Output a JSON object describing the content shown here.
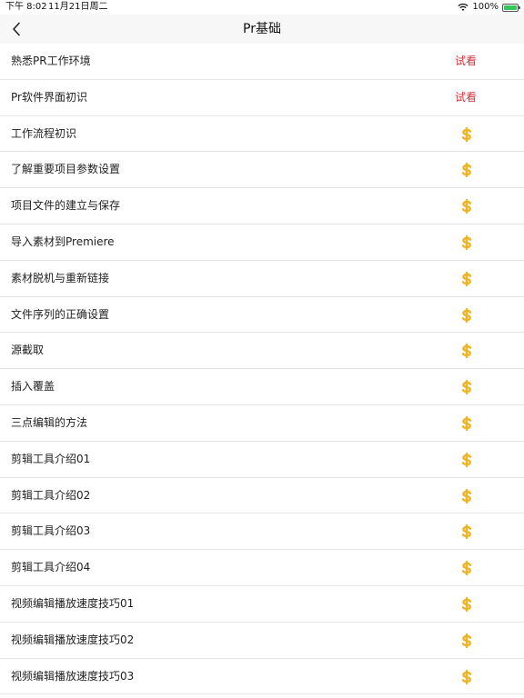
{
  "status_bar": {
    "time": "下午 8:02",
    "date": "11月21日周二",
    "battery": "100%",
    "wifi_icon": "wifi-icon",
    "battery_icon": "battery-icon",
    "battery_level": 1.0
  },
  "nav": {
    "title": "Pr基础",
    "back_icon": "chevron-left-icon"
  },
  "colors": {
    "trial": "#c8343a",
    "coin": "#f0b323",
    "nav_bg": "#f7f7f7",
    "divider": "#e6e6e6"
  },
  "lessons": [
    {
      "title": "熟悉PR工作环境",
      "badge": "试看",
      "type": "trial"
    },
    {
      "title": "Pr软件界面初识",
      "badge": "试看",
      "type": "trial"
    },
    {
      "title": "工作流程初识",
      "badge": "dollar-icon",
      "type": "paid"
    },
    {
      "title": "了解重要项目参数设置",
      "badge": "dollar-icon",
      "type": "paid"
    },
    {
      "title": "项目文件的建立与保存",
      "badge": "dollar-icon",
      "type": "paid"
    },
    {
      "title": "导入素材到Premiere",
      "badge": "dollar-icon",
      "type": "paid"
    },
    {
      "title": "素材脱机与重新链接",
      "badge": "dollar-icon",
      "type": "paid"
    },
    {
      "title": "文件序列的正确设置",
      "badge": "dollar-icon",
      "type": "paid"
    },
    {
      "title": "源截取",
      "badge": "dollar-icon",
      "type": "paid"
    },
    {
      "title": "插入覆盖",
      "badge": "dollar-icon",
      "type": "paid"
    },
    {
      "title": "三点编辑的方法",
      "badge": "dollar-icon",
      "type": "paid"
    },
    {
      "title": "剪辑工具介绍01",
      "badge": "dollar-icon",
      "type": "paid"
    },
    {
      "title": "剪辑工具介绍02",
      "badge": "dollar-icon",
      "type": "paid"
    },
    {
      "title": "剪辑工具介绍03",
      "badge": "dollar-icon",
      "type": "paid"
    },
    {
      "title": "剪辑工具介绍04",
      "badge": "dollar-icon",
      "type": "paid"
    },
    {
      "title": "视频编辑播放速度技巧01",
      "badge": "dollar-icon",
      "type": "paid"
    },
    {
      "title": "视频编辑播放速度技巧02",
      "badge": "dollar-icon",
      "type": "paid"
    },
    {
      "title": "视频编辑播放速度技巧03",
      "badge": "dollar-icon",
      "type": "paid"
    }
  ]
}
